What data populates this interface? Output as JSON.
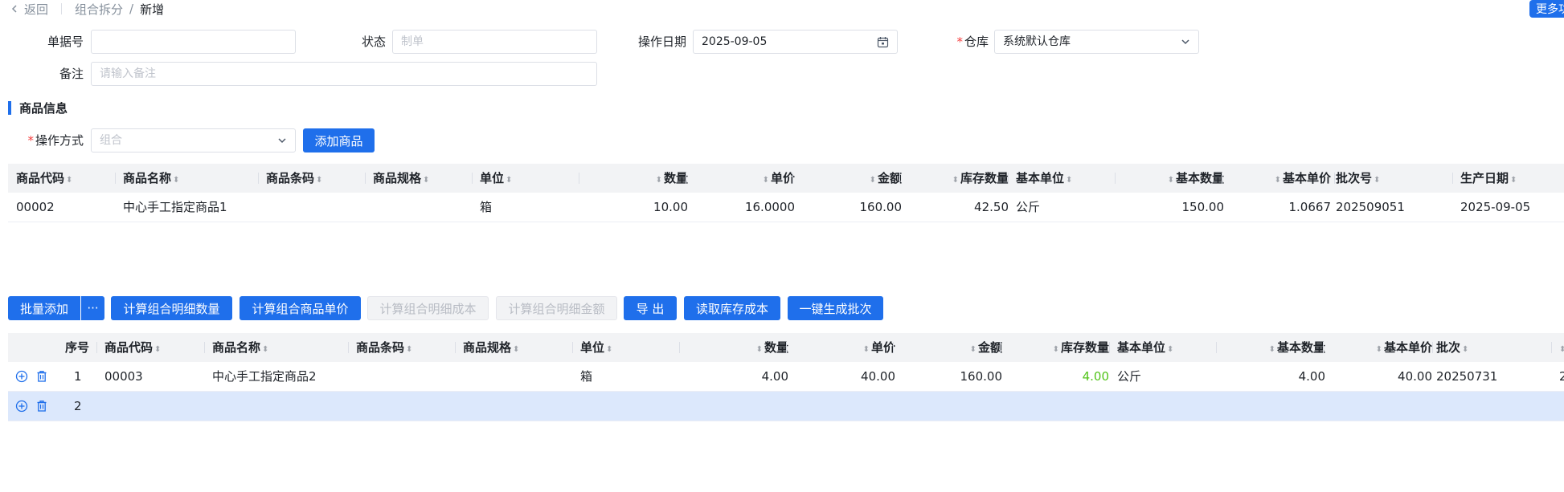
{
  "breadcrumb": {
    "back": "返回",
    "parent": "组合拆分",
    "current": "新增"
  },
  "more_button": "更多功",
  "form": {
    "doc_no": {
      "label": "单据号",
      "value": ""
    },
    "status": {
      "label": "状态",
      "placeholder": "制单"
    },
    "op_date": {
      "label": "操作日期",
      "value": "2025-09-05"
    },
    "warehouse": {
      "label": "仓库",
      "value": "系统默认仓库"
    },
    "remark": {
      "label": "备注",
      "placeholder": "请输入备注"
    }
  },
  "product_section": {
    "title": "商品信息",
    "op_mode": {
      "label": "操作方式",
      "placeholder": "组合"
    },
    "add_button": "添加商品"
  },
  "main_table": {
    "columns": [
      "商品代码",
      "商品名称",
      "商品条码",
      "商品规格",
      "单位",
      "数量",
      "单价",
      "金额",
      "库存数量",
      "基本单位",
      "基本数量",
      "基本单价",
      "批次号",
      "生产日期"
    ],
    "rows": [
      [
        "00002",
        "中心手工指定商品1",
        "",
        "",
        "箱",
        "10.00",
        "16.0000",
        "160.00",
        "42.50",
        "公斤",
        "150.00",
        "1.0667",
        "202509051",
        "2025-09-05"
      ]
    ]
  },
  "toolbar": {
    "batch_add": "批量添加",
    "more": "···",
    "calc_qty": "计算组合明细数量",
    "calc_price": "计算组合商品单价",
    "calc_cost": "计算组合明细成本",
    "calc_amount": "计算组合明细金额",
    "export": "导 出",
    "read_cost": "读取库存成本",
    "gen_batch": "一键生成批次"
  },
  "detail_table": {
    "columns": [
      "序号",
      "商品代码",
      "商品名称",
      "商品条码",
      "商品规格",
      "单位",
      "数量",
      "单价",
      "金额",
      "库存数量",
      "基本单位",
      "基本数量",
      "基本单价",
      "批次"
    ],
    "rows": [
      [
        "1",
        "00003",
        "中心手工指定商品2",
        "",
        "",
        "箱",
        "4.00",
        "40.00",
        "160.00",
        "4.00",
        "公斤",
        "4.00",
        "40.00",
        "20250731"
      ],
      [
        "2",
        "",
        "",
        "",
        "",
        "",
        "",
        "",
        "",
        "",
        "",
        "",
        "",
        ""
      ]
    ],
    "overflow_char": "2"
  },
  "colors": {
    "primary": "#1f6feb",
    "stock_positive": "#52c41a",
    "selected_row": "#dce8fc",
    "required": "#f53f3f"
  }
}
